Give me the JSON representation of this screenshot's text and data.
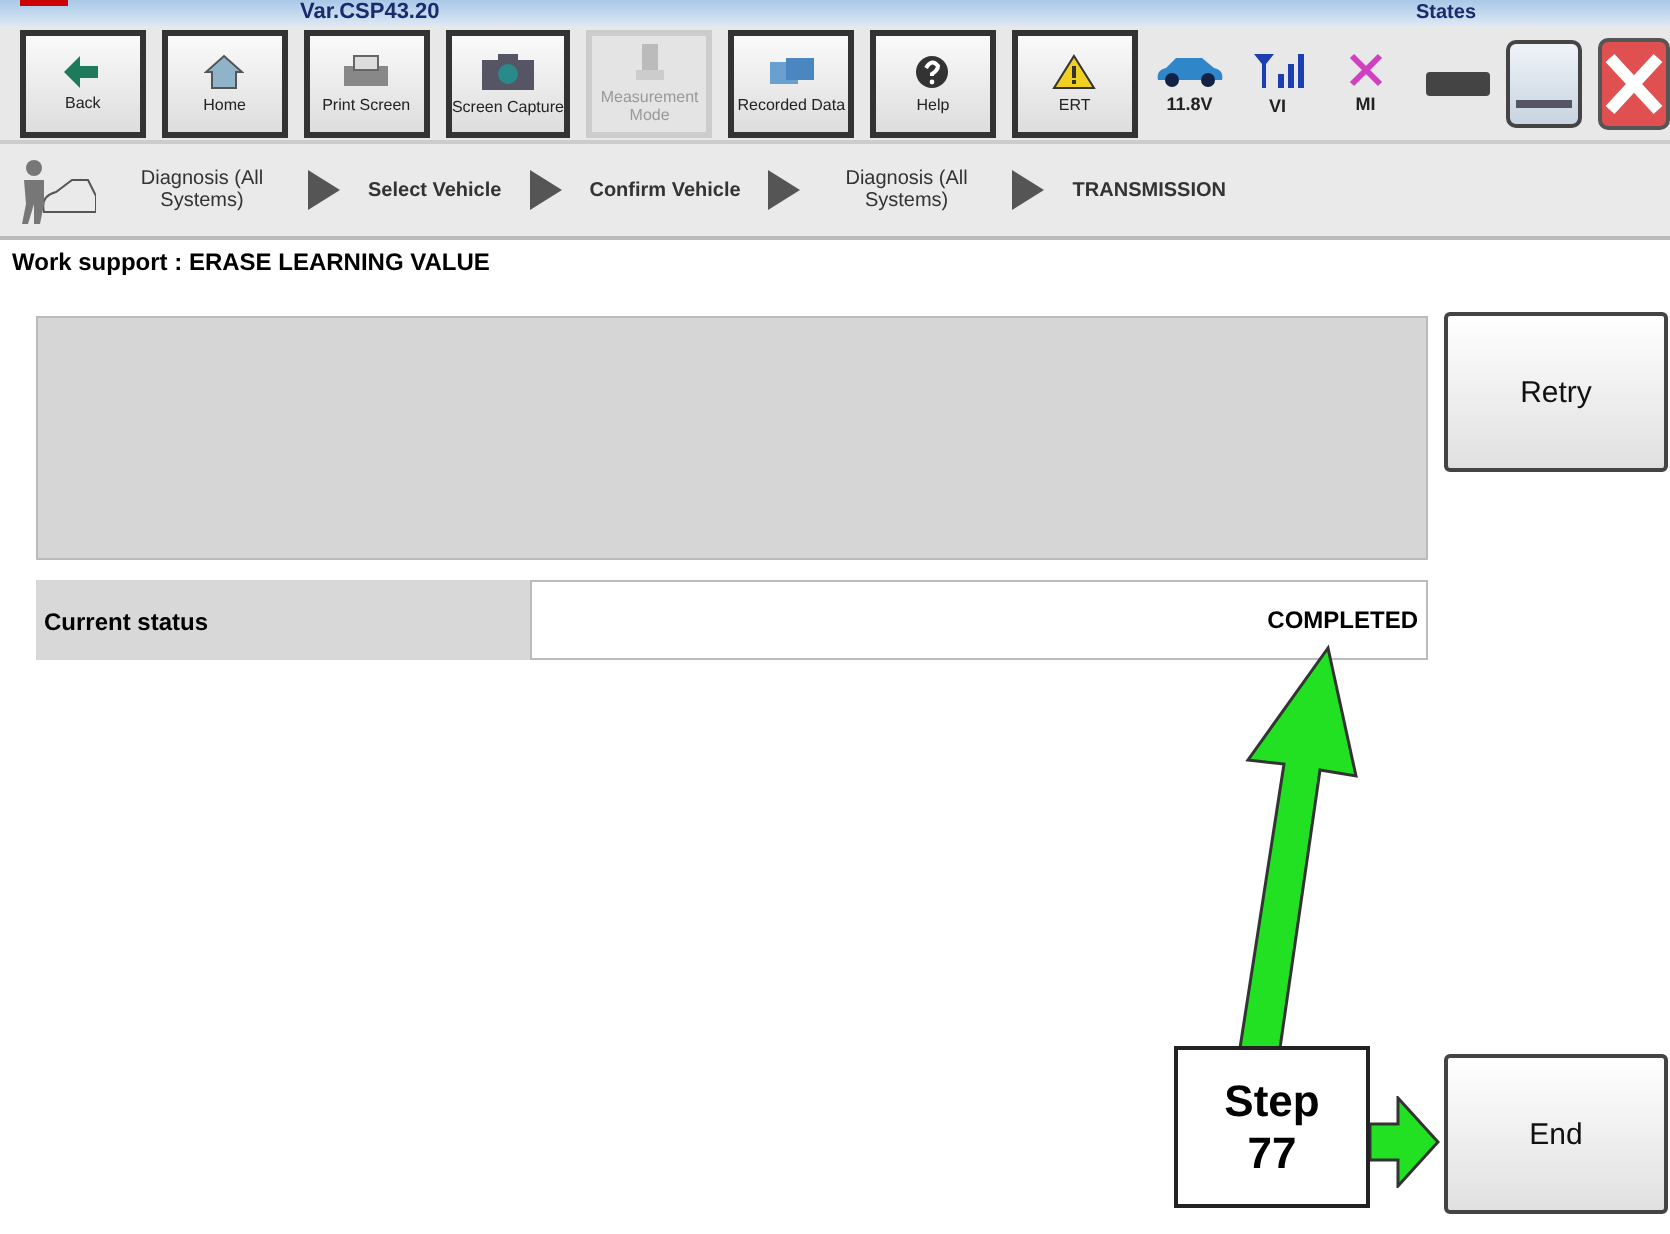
{
  "header": {
    "version": "Var.CSP43.20",
    "states_label": "States"
  },
  "toolbar": [
    {
      "label": "Back",
      "kind": "back",
      "disabled": false
    },
    {
      "label": "Home",
      "kind": "home",
      "disabled": false
    },
    {
      "label": "Print Screen",
      "kind": "printer",
      "disabled": false
    },
    {
      "label": "Screen Capture",
      "kind": "camera",
      "disabled": false
    },
    {
      "label": "Measurement Mode",
      "kind": "meter",
      "disabled": true
    },
    {
      "label": "Recorded Data",
      "kind": "data",
      "disabled": false
    },
    {
      "label": "Help",
      "kind": "help",
      "disabled": false
    },
    {
      "label": "ERT",
      "kind": "warning",
      "disabled": false
    }
  ],
  "status": [
    {
      "label": "11.8V",
      "kind": "car"
    },
    {
      "label": "VI",
      "kind": "signal"
    },
    {
      "label": "MI",
      "kind": "cross"
    }
  ],
  "breadcrumb": [
    "Diagnosis (All Systems)",
    "Select Vehicle",
    "Confirm Vehicle",
    "Diagnosis (All Systems)",
    "TRANSMISSION"
  ],
  "title": "Work support : ERASE LEARNING VALUE",
  "buttons": {
    "retry": "Retry",
    "end": "End"
  },
  "current_status": {
    "label": "Current status",
    "value": "COMPLETED"
  },
  "callout": {
    "text": "Step 77"
  }
}
